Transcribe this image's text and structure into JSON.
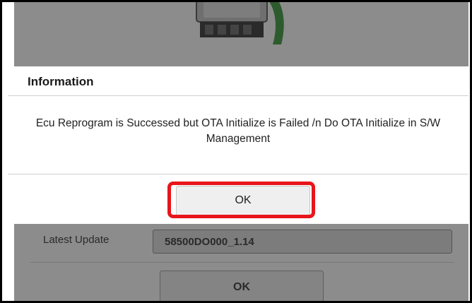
{
  "background": {
    "latest_update_label": "Latest Update",
    "latest_update_value": "58500DO000_1.14",
    "ok_label": "OK"
  },
  "dialog": {
    "title": "Information",
    "message": "Ecu Reprogram is Successed but OTA Initialize is Failed /n Do OTA Initialize in S/W Management",
    "ok_label": "OK"
  },
  "colors": {
    "highlight": "#e8151b",
    "overlay": "#8c8c8c",
    "dialog_bg": "#ffffff"
  },
  "icons": {
    "ecu_image": "ecu-module-icon"
  }
}
